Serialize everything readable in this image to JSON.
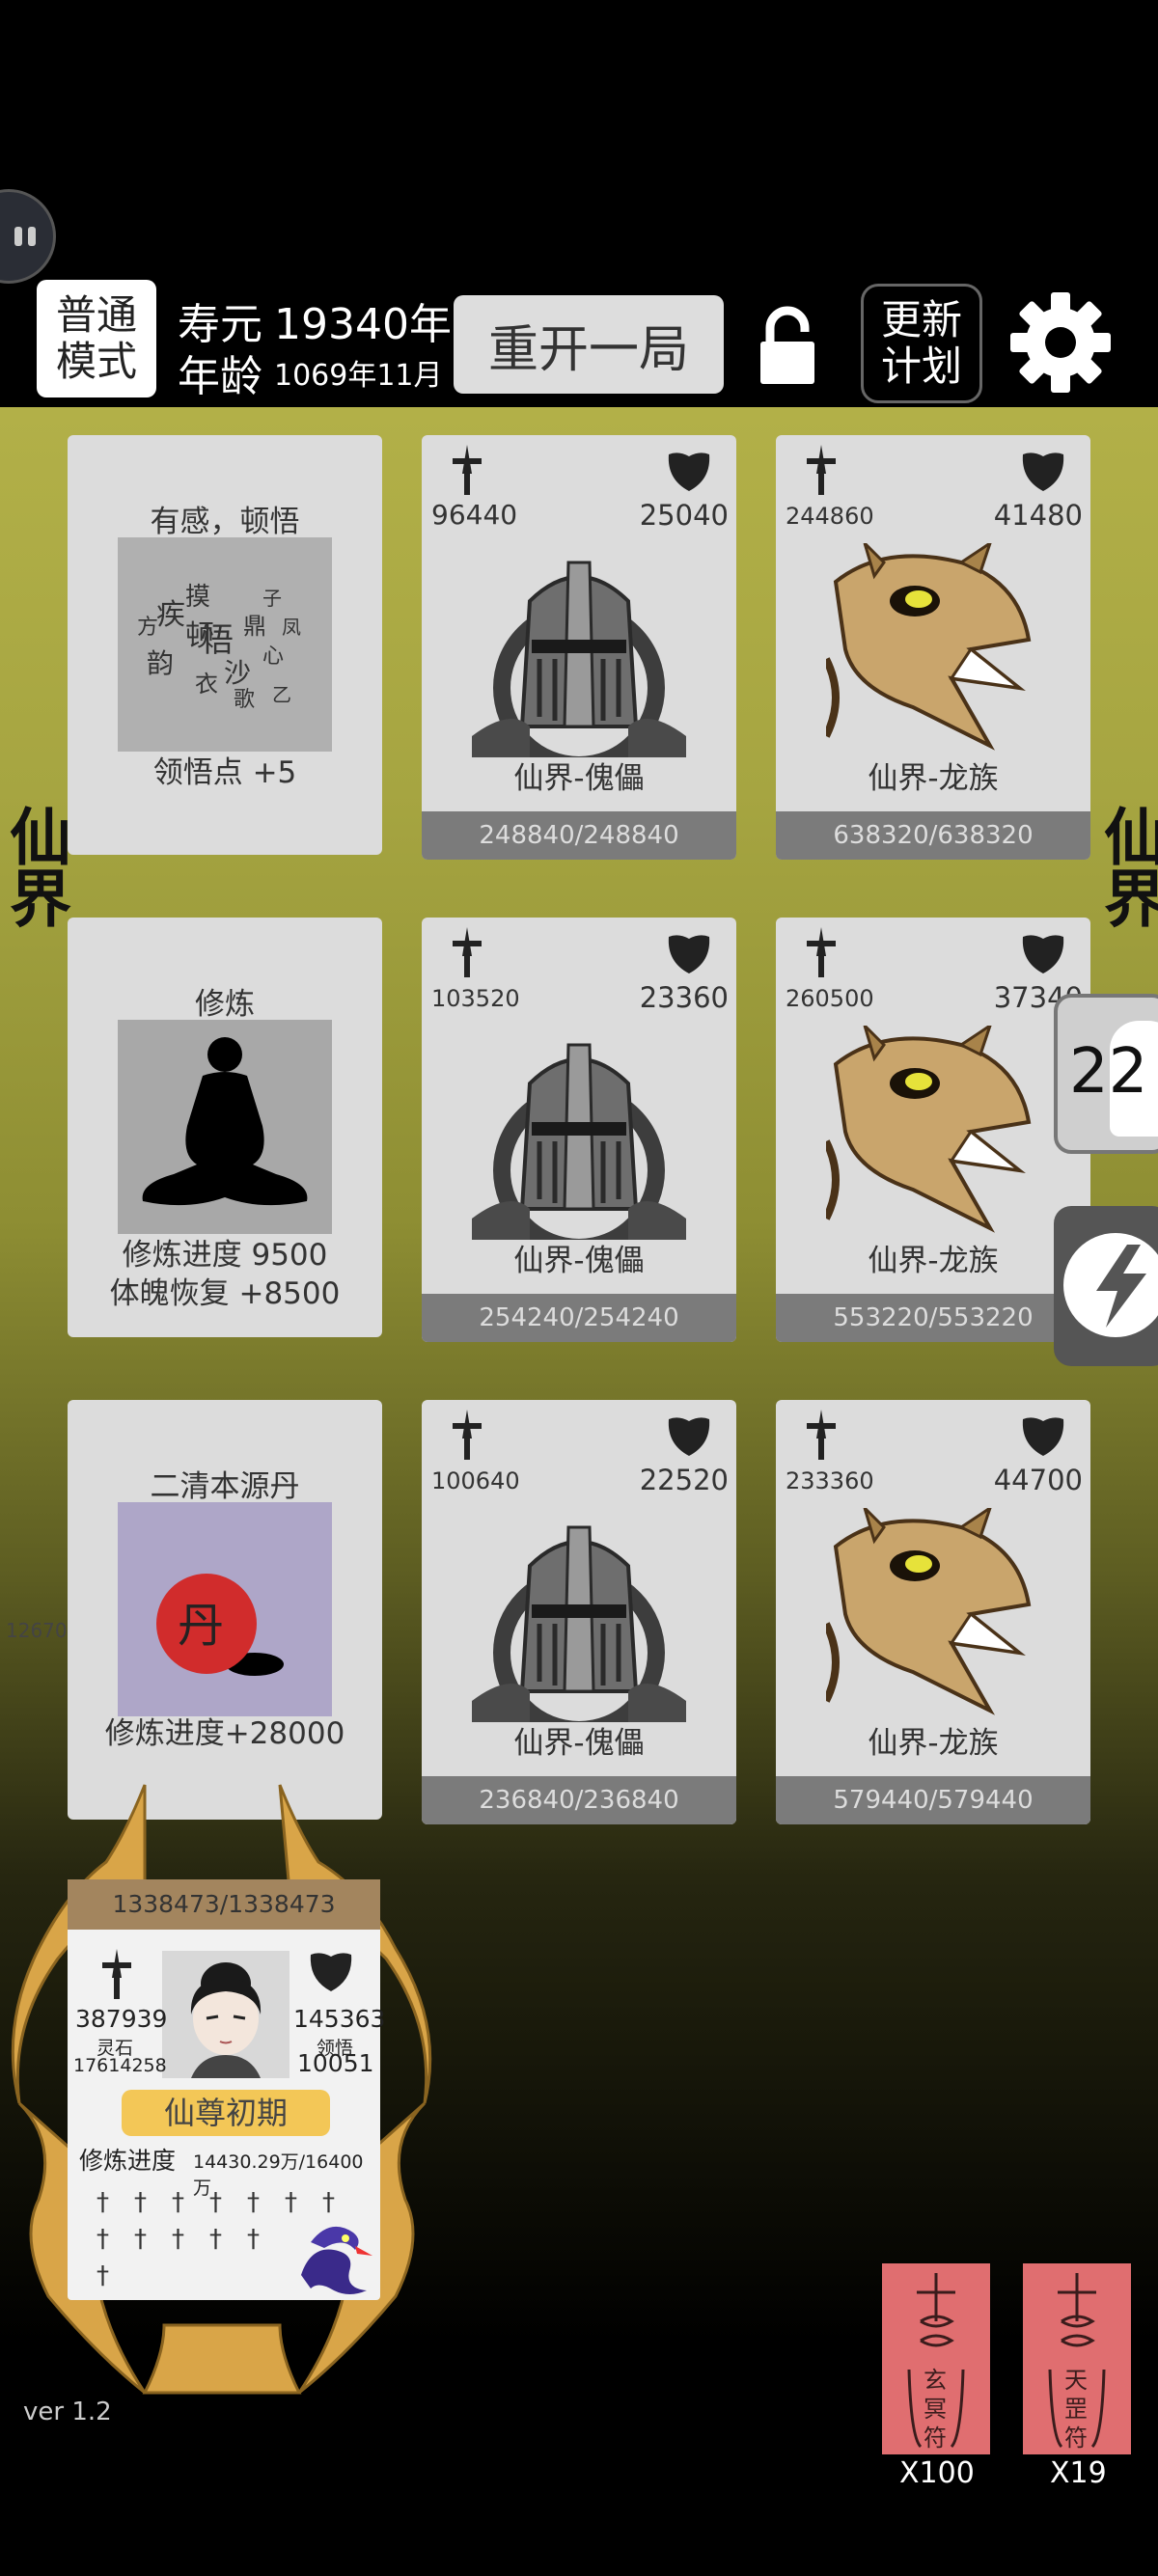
{
  "header": {
    "mode_label": "普通模式",
    "lifespan_label": "寿元",
    "lifespan_value": "19340年",
    "age_label": "年龄",
    "age_value": "1069年11月",
    "restart_label": "重开一局",
    "plan_label": "更新计划"
  },
  "side": {
    "left_text": "仙界",
    "right_text": "仙界",
    "bubble_count": "22",
    "left_marker": "12670"
  },
  "event_cards": [
    {
      "title": "有感，顿悟",
      "desc1": "领悟点  +5",
      "desc2": ""
    },
    {
      "title": "修炼",
      "desc1": "修炼进度  9500",
      "desc2": "体魄恢复  +8500"
    },
    {
      "title": "二清本源丹",
      "desc1": "修炼进度+28000",
      "desc2": ""
    }
  ],
  "enemies": [
    {
      "atk": "96440",
      "def": "25040",
      "name": "仙界-傀儡",
      "hp": "248840/248840",
      "kind": "golem"
    },
    {
      "atk": "244860",
      "def": "41480",
      "name": "仙界-龙族",
      "hp": "638320/638320",
      "kind": "dragon"
    },
    {
      "atk": "103520",
      "def": "23360",
      "name": "仙界-傀儡",
      "hp": "254240/254240",
      "kind": "golem"
    },
    {
      "atk": "260500",
      "def": "37340",
      "name": "仙界-龙族",
      "hp": "553220/553220",
      "kind": "dragon"
    },
    {
      "atk": "100640",
      "def": "22520",
      "name": "仙界-傀儡",
      "hp": "236840/236840",
      "kind": "golem"
    },
    {
      "atk": "233360",
      "def": "44700",
      "name": "仙界-龙族",
      "hp": "579440/579440",
      "kind": "dragon"
    }
  ],
  "player": {
    "hp": "1338473/1338473",
    "atk": "387939",
    "spirit_stone_label": "灵石",
    "spirit_stone": "17614258",
    "def": "145363",
    "insight_label": "领悟",
    "insight": "10051",
    "realm": "仙尊初期",
    "progress_label": "修炼进度",
    "progress_value": "14430.29万/16400万",
    "sword_count": 13
  },
  "footer": {
    "version": "ver 1.2",
    "talisman1_count": "X100",
    "talisman2_count": "X19",
    "talisman1_text": "玄冥符",
    "talisman2_text": "天罡符"
  },
  "colors": {
    "mode_bg": "#ffffff",
    "card_bg": "#dcdcdc",
    "hp_bar": "#7b7b7b",
    "player_hp_bar": "#a3855e",
    "realm_badge": "#f3c757",
    "talisman": "#e06e70"
  }
}
